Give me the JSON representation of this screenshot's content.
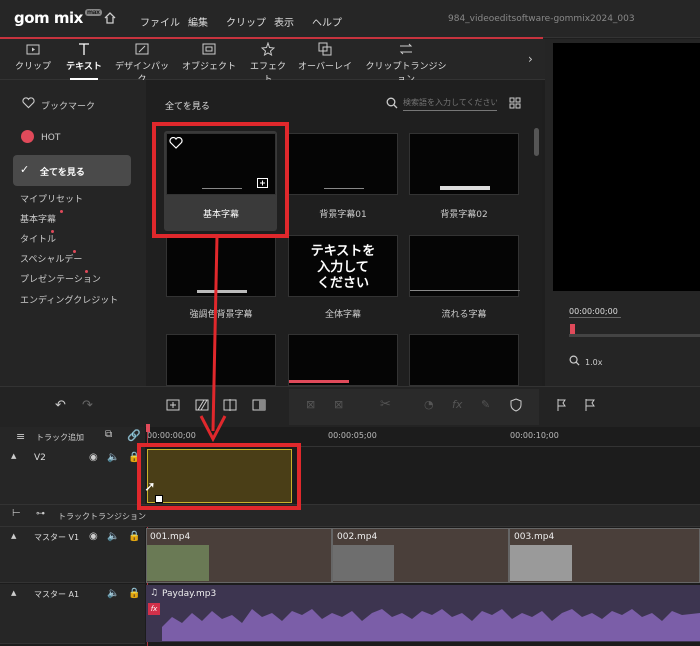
{
  "app": {
    "logo": "gom mix",
    "logo_badge": "max",
    "window_title": "984_videoeditsoftware-gommix2024_003"
  },
  "menu": [
    "ファイル",
    "編集",
    "クリップ",
    "表示",
    "ヘルプ"
  ],
  "tabs": [
    {
      "label": "クリップ"
    },
    {
      "label": "テキスト"
    },
    {
      "label": "デザインパック"
    },
    {
      "label": "オブジェクト"
    },
    {
      "label": "エフェクト"
    },
    {
      "label": "オーバーレイ"
    },
    {
      "label": "クリップトランジション"
    }
  ],
  "sidebar": {
    "bookmark": "ブックマーク",
    "hot": "HOT",
    "all": "全てを見る",
    "items": [
      "マイプリセット",
      "基本字幕",
      "タイトル",
      "スペシャルデー",
      "プレゼンテーション",
      "エンディングクレジット"
    ]
  },
  "content": {
    "heading": "全てを見る",
    "search_placeholder": "検索語を入力してください。",
    "thumbs": [
      {
        "label": "基本字幕"
      },
      {
        "label": "背景字幕01"
      },
      {
        "label": "背景字幕02"
      },
      {
        "label": "強調色背景字幕"
      },
      {
        "label": "全体字幕",
        "text": "テキストを\n入力して\nください"
      },
      {
        "label": "流れる字幕"
      }
    ]
  },
  "preview": {
    "timecode": "00:00:00;00",
    "zoom": "1.0x"
  },
  "timeline": {
    "add_track": "トラック追加",
    "ruler": [
      "00:00:00;00",
      "00:00:05;00",
      "00:00:10;00"
    ],
    "tracks": {
      "v2": "V2",
      "transition": "トラックトランジション",
      "v1": "マスター V1",
      "a1": "マスター A1"
    },
    "clips": [
      "001.mp4",
      "002.mp4",
      "003.mp4"
    ],
    "audio": "Payday.mp3",
    "fx": "fx"
  }
}
